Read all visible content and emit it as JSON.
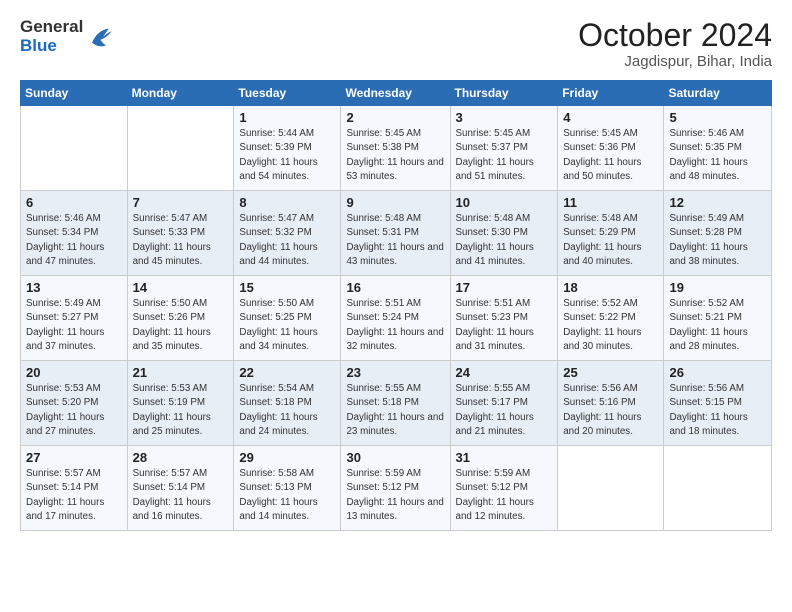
{
  "logo": {
    "general": "General",
    "blue": "Blue"
  },
  "title": "October 2024",
  "location": "Jagdispur, Bihar, India",
  "days_of_week": [
    "Sunday",
    "Monday",
    "Tuesday",
    "Wednesday",
    "Thursday",
    "Friday",
    "Saturday"
  ],
  "weeks": [
    [
      {
        "day": "",
        "info": ""
      },
      {
        "day": "",
        "info": ""
      },
      {
        "day": "1",
        "info": "Sunrise: 5:44 AM\nSunset: 5:39 PM\nDaylight: 11 hours and 54 minutes."
      },
      {
        "day": "2",
        "info": "Sunrise: 5:45 AM\nSunset: 5:38 PM\nDaylight: 11 hours and 53 minutes."
      },
      {
        "day": "3",
        "info": "Sunrise: 5:45 AM\nSunset: 5:37 PM\nDaylight: 11 hours and 51 minutes."
      },
      {
        "day": "4",
        "info": "Sunrise: 5:45 AM\nSunset: 5:36 PM\nDaylight: 11 hours and 50 minutes."
      },
      {
        "day": "5",
        "info": "Sunrise: 5:46 AM\nSunset: 5:35 PM\nDaylight: 11 hours and 48 minutes."
      }
    ],
    [
      {
        "day": "6",
        "info": "Sunrise: 5:46 AM\nSunset: 5:34 PM\nDaylight: 11 hours and 47 minutes."
      },
      {
        "day": "7",
        "info": "Sunrise: 5:47 AM\nSunset: 5:33 PM\nDaylight: 11 hours and 45 minutes."
      },
      {
        "day": "8",
        "info": "Sunrise: 5:47 AM\nSunset: 5:32 PM\nDaylight: 11 hours and 44 minutes."
      },
      {
        "day": "9",
        "info": "Sunrise: 5:48 AM\nSunset: 5:31 PM\nDaylight: 11 hours and 43 minutes."
      },
      {
        "day": "10",
        "info": "Sunrise: 5:48 AM\nSunset: 5:30 PM\nDaylight: 11 hours and 41 minutes."
      },
      {
        "day": "11",
        "info": "Sunrise: 5:48 AM\nSunset: 5:29 PM\nDaylight: 11 hours and 40 minutes."
      },
      {
        "day": "12",
        "info": "Sunrise: 5:49 AM\nSunset: 5:28 PM\nDaylight: 11 hours and 38 minutes."
      }
    ],
    [
      {
        "day": "13",
        "info": "Sunrise: 5:49 AM\nSunset: 5:27 PM\nDaylight: 11 hours and 37 minutes."
      },
      {
        "day": "14",
        "info": "Sunrise: 5:50 AM\nSunset: 5:26 PM\nDaylight: 11 hours and 35 minutes."
      },
      {
        "day": "15",
        "info": "Sunrise: 5:50 AM\nSunset: 5:25 PM\nDaylight: 11 hours and 34 minutes."
      },
      {
        "day": "16",
        "info": "Sunrise: 5:51 AM\nSunset: 5:24 PM\nDaylight: 11 hours and 32 minutes."
      },
      {
        "day": "17",
        "info": "Sunrise: 5:51 AM\nSunset: 5:23 PM\nDaylight: 11 hours and 31 minutes."
      },
      {
        "day": "18",
        "info": "Sunrise: 5:52 AM\nSunset: 5:22 PM\nDaylight: 11 hours and 30 minutes."
      },
      {
        "day": "19",
        "info": "Sunrise: 5:52 AM\nSunset: 5:21 PM\nDaylight: 11 hours and 28 minutes."
      }
    ],
    [
      {
        "day": "20",
        "info": "Sunrise: 5:53 AM\nSunset: 5:20 PM\nDaylight: 11 hours and 27 minutes."
      },
      {
        "day": "21",
        "info": "Sunrise: 5:53 AM\nSunset: 5:19 PM\nDaylight: 11 hours and 25 minutes."
      },
      {
        "day": "22",
        "info": "Sunrise: 5:54 AM\nSunset: 5:18 PM\nDaylight: 11 hours and 24 minutes."
      },
      {
        "day": "23",
        "info": "Sunrise: 5:55 AM\nSunset: 5:18 PM\nDaylight: 11 hours and 23 minutes."
      },
      {
        "day": "24",
        "info": "Sunrise: 5:55 AM\nSunset: 5:17 PM\nDaylight: 11 hours and 21 minutes."
      },
      {
        "day": "25",
        "info": "Sunrise: 5:56 AM\nSunset: 5:16 PM\nDaylight: 11 hours and 20 minutes."
      },
      {
        "day": "26",
        "info": "Sunrise: 5:56 AM\nSunset: 5:15 PM\nDaylight: 11 hours and 18 minutes."
      }
    ],
    [
      {
        "day": "27",
        "info": "Sunrise: 5:57 AM\nSunset: 5:14 PM\nDaylight: 11 hours and 17 minutes."
      },
      {
        "day": "28",
        "info": "Sunrise: 5:57 AM\nSunset: 5:14 PM\nDaylight: 11 hours and 16 minutes."
      },
      {
        "day": "29",
        "info": "Sunrise: 5:58 AM\nSunset: 5:13 PM\nDaylight: 11 hours and 14 minutes."
      },
      {
        "day": "30",
        "info": "Sunrise: 5:59 AM\nSunset: 5:12 PM\nDaylight: 11 hours and 13 minutes."
      },
      {
        "day": "31",
        "info": "Sunrise: 5:59 AM\nSunset: 5:12 PM\nDaylight: 11 hours and 12 minutes."
      },
      {
        "day": "",
        "info": ""
      },
      {
        "day": "",
        "info": ""
      }
    ]
  ]
}
